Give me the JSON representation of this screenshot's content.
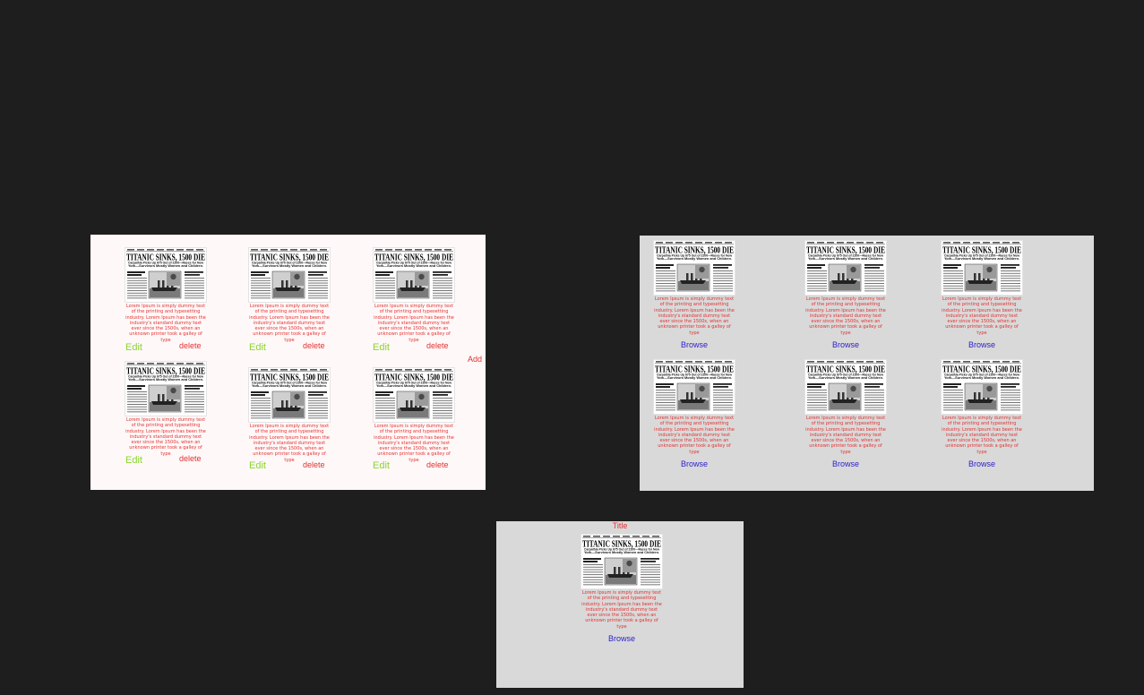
{
  "newspaper": {
    "headline": "TITANIC SINKS, 1500 DIE",
    "subheadline": "Carpathia Picks Up 675 Out of 2200—Races for New York—Survivors Mostly Women and Children."
  },
  "admin_panel": {
    "add_label": "Add",
    "cards": [
      {
        "description": "Lorem Ipsum is simply dummy text of the printing and typesetting industry. Lorem Ipsum has been the industry's standard dummy text ever since the 1500s, when an unknown printer took a galley of type",
        "edit_label": "Edit",
        "delete_label": "delete"
      },
      {
        "description": "Lorem Ipsum is simply dummy text of the printing and typesetting industry. Lorem Ipsum has been the industry's standard dummy text ever since the 1500s, when an unknown printer took a galley of type",
        "edit_label": "Edit",
        "delete_label": "delete"
      },
      {
        "description": "Lorem Ipsum is simply dummy text of the printing and typesetting industry. Lorem Ipsum has been the industry's standard dummy text ever since the 1500s, when an unknown printer took a galley of type",
        "edit_label": "Edit",
        "delete_label": "delete"
      },
      {
        "description": "Lorem Ipsum is simply dummy text of the printing and typesetting industry. Lorem Ipsum has been the industry's standard dummy text ever since the 1500s, when an unknown printer took a galley of type",
        "edit_label": "Edit",
        "delete_label": "delete"
      },
      {
        "description": "Lorem Ipsum is simply dummy text of the printing and typesetting industry. Lorem Ipsum has been the industry's standard dummy text ever since the 1500s, when an unknown printer took a galley of type",
        "edit_label": "Edit",
        "delete_label": "delete"
      },
      {
        "description": "Lorem Ipsum is simply dummy text of the printing and typesetting industry. Lorem Ipsum has been the industry's standard dummy text ever since the 1500s, when an unknown printer took a galley of type",
        "edit_label": "Edit",
        "delete_label": "delete"
      }
    ]
  },
  "browse_panel": {
    "cards": [
      {
        "description": "Lorem Ipsum is simply dummy text of the printing and typesetting industry. Lorem Ipsum has been the industry's standard dummy text ever since the 1500s, when an unknown printer took a galley of type",
        "browse_label": "Browse"
      },
      {
        "description": "Lorem Ipsum is simply dummy text of the printing and typesetting industry. Lorem Ipsum has been the industry's standard dummy text ever since the 1500s, when an unknown printer took a galley of type",
        "browse_label": "Browse"
      },
      {
        "description": "Lorem Ipsum is simply dummy text of the printing and typesetting industry. Lorem Ipsum has been the industry's standard dummy text ever since the 1500s, when an unknown printer took a galley of type",
        "browse_label": "Browse"
      },
      {
        "description": "Lorem Ipsum is simply dummy text of the printing and typesetting industry. Lorem Ipsum has been the industry's standard dummy text ever since the 1500s, when an unknown printer took a galley of type",
        "browse_label": "Browse"
      },
      {
        "description": "Lorem Ipsum is simply dummy text of the printing and typesetting industry. Lorem Ipsum has been the industry's standard dummy text ever since the 1500s, when an unknown printer took a galley of type",
        "browse_label": "Browse"
      },
      {
        "description": "Lorem Ipsum is simply dummy text of the printing and typesetting industry. Lorem Ipsum has been the industry's standard dummy text ever since the 1500s, when an unknown printer took a galley of type",
        "browse_label": "Browse"
      }
    ]
  },
  "detail_panel": {
    "title": "Title",
    "description": "Lorem Ipsum is simply dummy text of the printing and typesetting industry. Lorem Ipsum has been the industry's standard dummy text ever since the 1500s, when an unknown printer took a galley of type",
    "browse_label": "Browse"
  },
  "colors": {
    "canvas_bg": "#1e1e1e",
    "admin_bg": "#fff8f8",
    "panel_bg": "#d9d9d9",
    "edit": "#8bd430",
    "delete": "#e33232",
    "browse": "#2b1fc9"
  }
}
